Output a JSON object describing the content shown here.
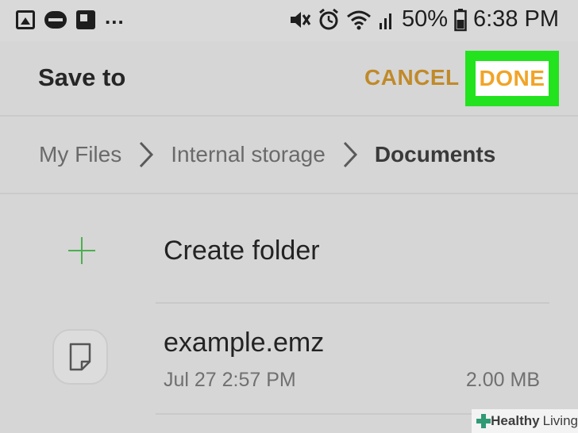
{
  "status_bar": {
    "left_icons": [
      "gallery-icon",
      "news-icon",
      "flipboard-icon"
    ],
    "more": "...",
    "battery_percent": "50%",
    "time": "6:38 PM",
    "right_icons": [
      "mute-icon",
      "alarm-icon",
      "wifi-icon",
      "signal-icon",
      "battery-icon"
    ]
  },
  "top_bar": {
    "title": "Save to",
    "cancel_label": "CANCEL",
    "done_label": "DONE"
  },
  "breadcrumb": {
    "items": [
      "My Files",
      "Internal storage",
      "Documents"
    ]
  },
  "list": {
    "create_folder_label": "Create folder",
    "files": [
      {
        "name": "example.emz",
        "date": "Jul 27 2:57 PM",
        "size": "2.00 MB"
      }
    ]
  },
  "watermark": {
    "part1": "Healthy",
    "part2": "Living"
  },
  "colors": {
    "highlight": "#22e31e",
    "cancel_text": "#c08a2a",
    "done_text": "#f1a428",
    "plus": "#4caf50"
  }
}
